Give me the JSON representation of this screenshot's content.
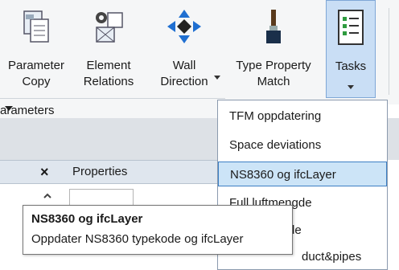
{
  "ribbon": {
    "buttons": [
      {
        "label": "Parameter\nCopy",
        "icon": "parameter-copy-icon"
      },
      {
        "label": "Element\nRelations",
        "icon": "element-relations-icon"
      },
      {
        "label": "Wall\nDirection",
        "icon": "wall-direction-icon"
      },
      {
        "label": "Type Property\nMatch",
        "icon": "paintbrush-icon"
      },
      {
        "label": "Tasks",
        "icon": "tasks-checklist-icon"
      }
    ],
    "panel_label": "arameters"
  },
  "properties": {
    "close": "×",
    "title": "Properties"
  },
  "tasks_menu": {
    "items": [
      "TFM oppdatering",
      "Space deviations",
      "NS8360 og ifcLayer",
      "Full luftmengde",
      "engde",
      "duct&pipes"
    ],
    "selected_index": 2
  },
  "tooltip": {
    "title": "NS8360 og ifcLayer",
    "description": "Oppdater NS8360 typekode og ifcLayer"
  },
  "colors": {
    "selection_fill": "#cce4f7",
    "selection_border": "#3d7fc4",
    "ribbon_bg": "#f5f6f7",
    "accent_blue": "#1f6fd1"
  }
}
